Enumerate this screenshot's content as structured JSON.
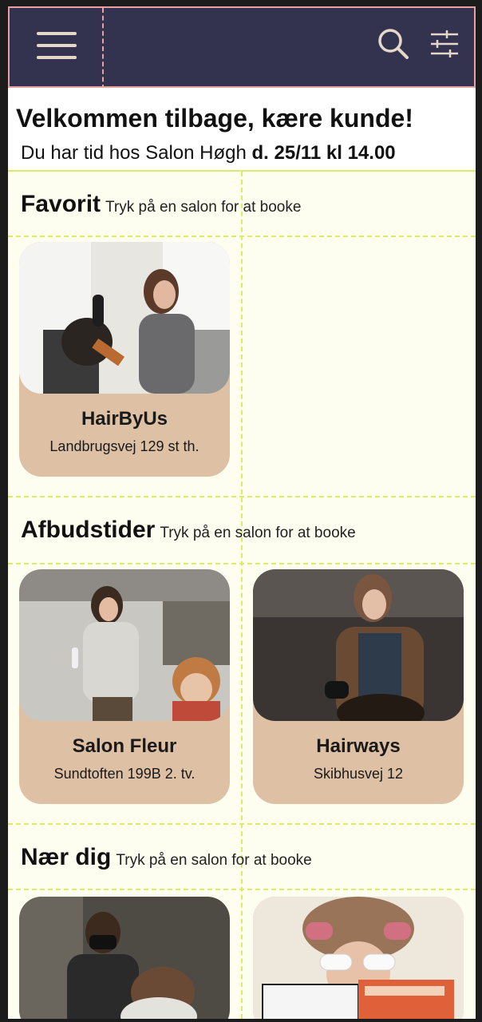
{
  "header": {
    "menu_icon": "hamburger-icon",
    "search_icon": "search-icon",
    "filter_icon": "sliders-icon"
  },
  "welcome": {
    "title": "Velkommen tilbage, kære kunde!",
    "appointment_prefix": "Du har tid hos Salon Høgh ",
    "appointment_time": "d. 25/11 kl 14.00"
  },
  "sections": {
    "favorites": {
      "title": "Favorit",
      "hint": "Tryk på en salon for at booke",
      "cards": [
        {
          "name": "HairByUs",
          "address": "Landbrugsvej 129 st th."
        }
      ]
    },
    "cancellations": {
      "title": "Afbudstider",
      "hint": "Tryk på en salon for at booke",
      "cards": [
        {
          "name": "Salon Fleur",
          "address": "Sundtoften 199B 2. tv."
        },
        {
          "name": "Hairways",
          "address": "Skibhusvej 12"
        }
      ]
    },
    "nearby": {
      "title": "Nær dig",
      "hint": "Tryk på en salon for at booke"
    }
  },
  "colors": {
    "header_bg": "#34334f",
    "card_bg": "#dec0a4",
    "content_bg": "#fdfdf0",
    "accent_line": "#dbee62",
    "icon_color": "#e6d8c8"
  }
}
